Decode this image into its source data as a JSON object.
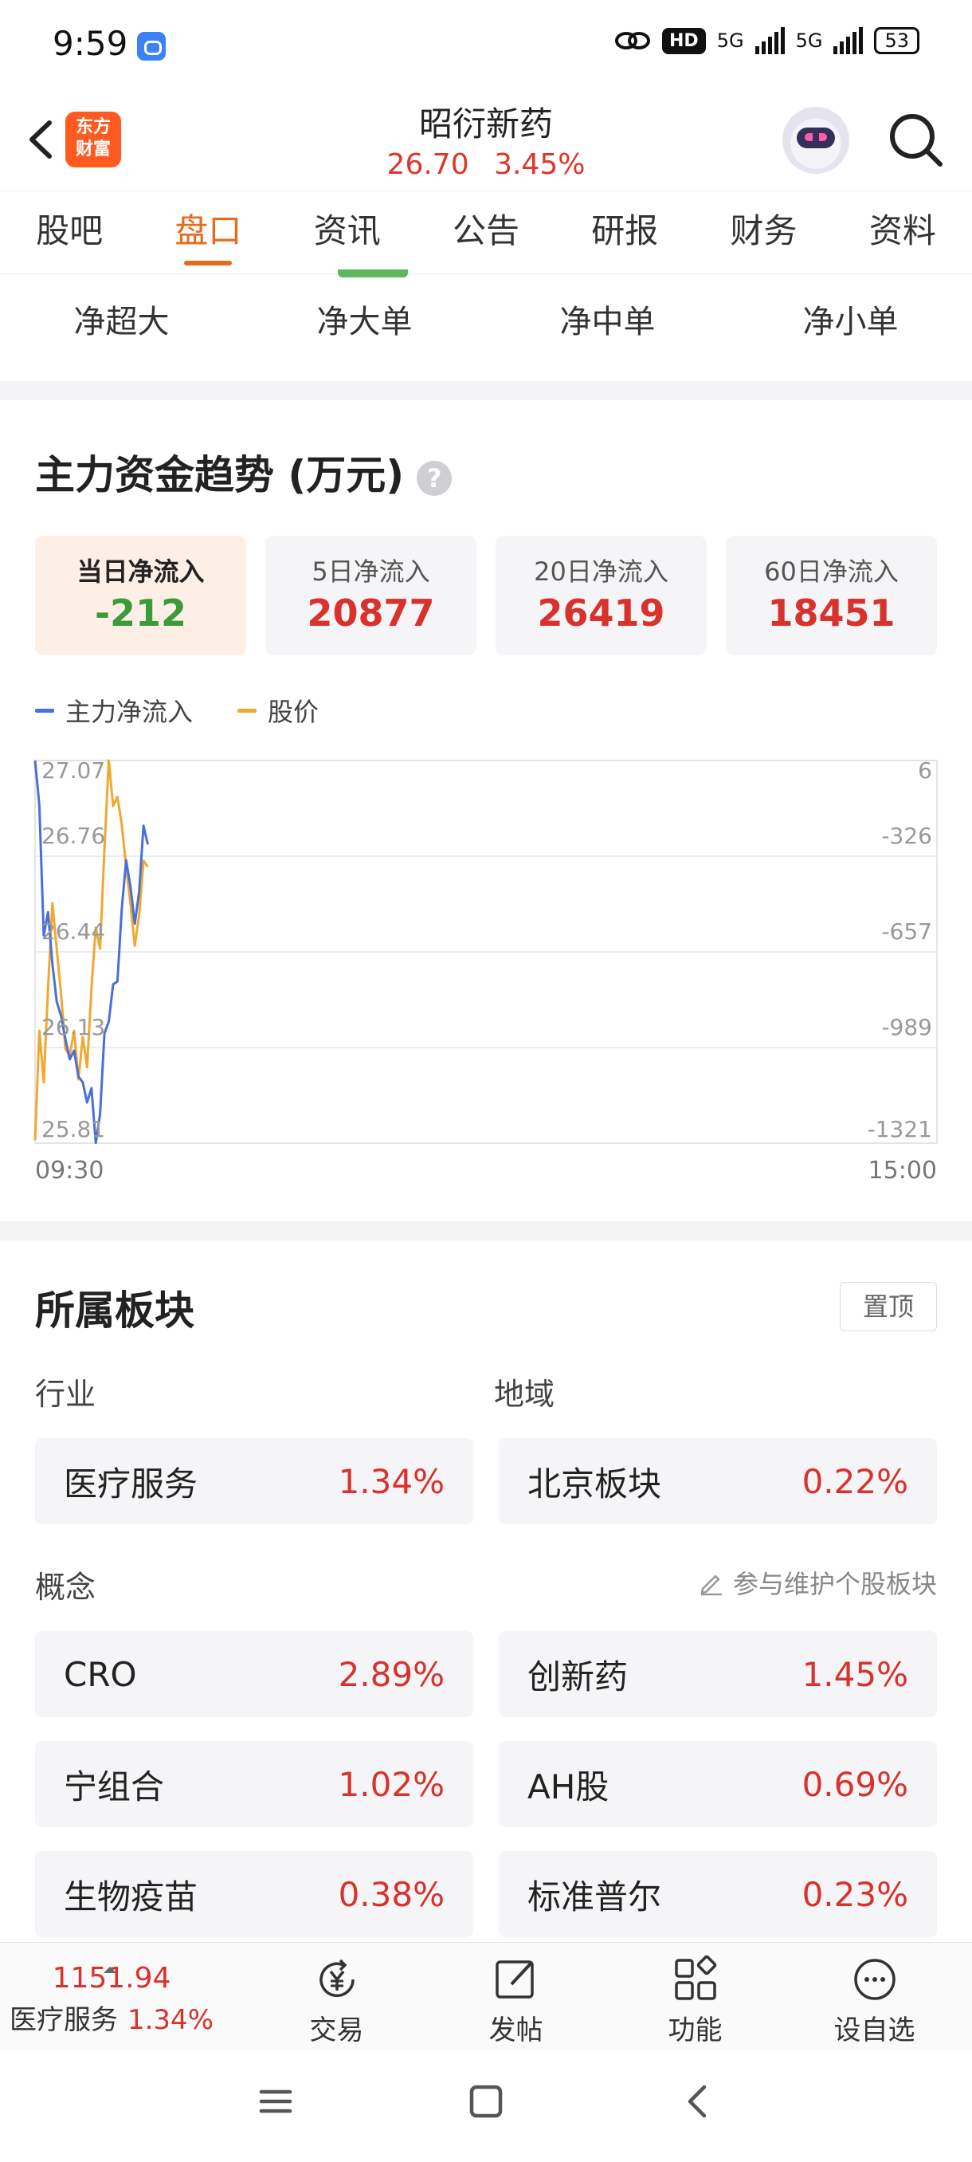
{
  "status_bar": {
    "time": "9:59",
    "hd": "HD",
    "net1": "5G",
    "net2": "5G",
    "battery": "53"
  },
  "header": {
    "logo_line1": "东方",
    "logo_line2": "财富",
    "stock_name": "昭衍新药",
    "price": "26.70",
    "change_pct": "3.45%"
  },
  "tabs": [
    "股吧",
    "盘口",
    "资讯",
    "公告",
    "研报",
    "财务",
    "资料"
  ],
  "active_tab": "盘口",
  "sub_tabs": [
    "净超大",
    "净大单",
    "净中单",
    "净小单"
  ],
  "capital_flow": {
    "title": "主力资金趋势 (万元)",
    "help": "?",
    "cards": [
      {
        "label": "当日净流入",
        "value": "-212"
      },
      {
        "label": "5日净流入",
        "value": "20877"
      },
      {
        "label": "20日净流入",
        "value": "26419"
      },
      {
        "label": "60日净流入",
        "value": "18451"
      }
    ],
    "legend": [
      "主力净流入",
      "股价"
    ]
  },
  "colors": {
    "accent": "#e86a1c",
    "up": "#d9312b",
    "down": "#3a9b3a",
    "flow_line": "#4a6fd8",
    "price_line": "#f0a830"
  },
  "chart_data": {
    "type": "line",
    "x_start_label": "09:30",
    "x_end_label": "15:00",
    "price_axis": {
      "ticks": [
        "27.07",
        "26.76",
        "26.44",
        "26.13",
        "25.81"
      ],
      "ylim": [
        25.81,
        27.07
      ]
    },
    "flow_axis": {
      "ticks": [
        "6",
        "-326",
        "-657",
        "-989",
        "-1321"
      ],
      "ylim": [
        -1321,
        6
      ]
    },
    "series": [
      {
        "name": "主力净流入",
        "values": [
          6,
          -150,
          -600,
          -520,
          -700,
          -830,
          -880,
          -960,
          -1030,
          -1000,
          -1090,
          -1110,
          -1180,
          -1130,
          -1320,
          -1220,
          -940,
          -900,
          -770,
          -760,
          -510,
          -340,
          -430,
          -560,
          -450,
          -220,
          -285
        ]
      },
      {
        "name": "股价",
        "values": [
          25.82,
          26.18,
          26.01,
          26.32,
          26.6,
          26.45,
          26.3,
          26.12,
          26.1,
          26.18,
          26.02,
          26.16,
          26.06,
          26.32,
          26.52,
          26.45,
          26.78,
          27.07,
          26.92,
          26.95,
          26.86,
          26.72,
          26.6,
          26.46,
          26.56,
          26.74,
          26.72
        ]
      }
    ]
  },
  "sectors": {
    "title": "所属板块",
    "pin_label": "置顶",
    "industry_label": "行业",
    "region_label": "地域",
    "industry": {
      "name": "医疗服务",
      "pct": "1.34%"
    },
    "region": {
      "name": "北京板块",
      "pct": "0.22%"
    },
    "concept_label": "概念",
    "maintain_label": "参与维护个股板块",
    "concepts": [
      {
        "name": "CRO",
        "pct": "2.89%"
      },
      {
        "name": "创新药",
        "pct": "1.45%"
      },
      {
        "name": "宁组合",
        "pct": "1.02%"
      },
      {
        "name": "AH股",
        "pct": "0.69%"
      },
      {
        "name": "生物疫苗",
        "pct": "0.38%"
      },
      {
        "name": "标准普尔",
        "pct": "0.23%"
      }
    ]
  },
  "bottom_bar": {
    "index_price": "1151.94",
    "index_name": "医疗服务",
    "index_pct": "1.34%",
    "actions": [
      {
        "label": "交易",
        "icon": "yen-trade-icon"
      },
      {
        "label": "发帖",
        "icon": "edit-post-icon"
      },
      {
        "label": "功能",
        "icon": "grid-apps-icon"
      },
      {
        "label": "设自选",
        "icon": "more-dots-icon"
      }
    ]
  }
}
